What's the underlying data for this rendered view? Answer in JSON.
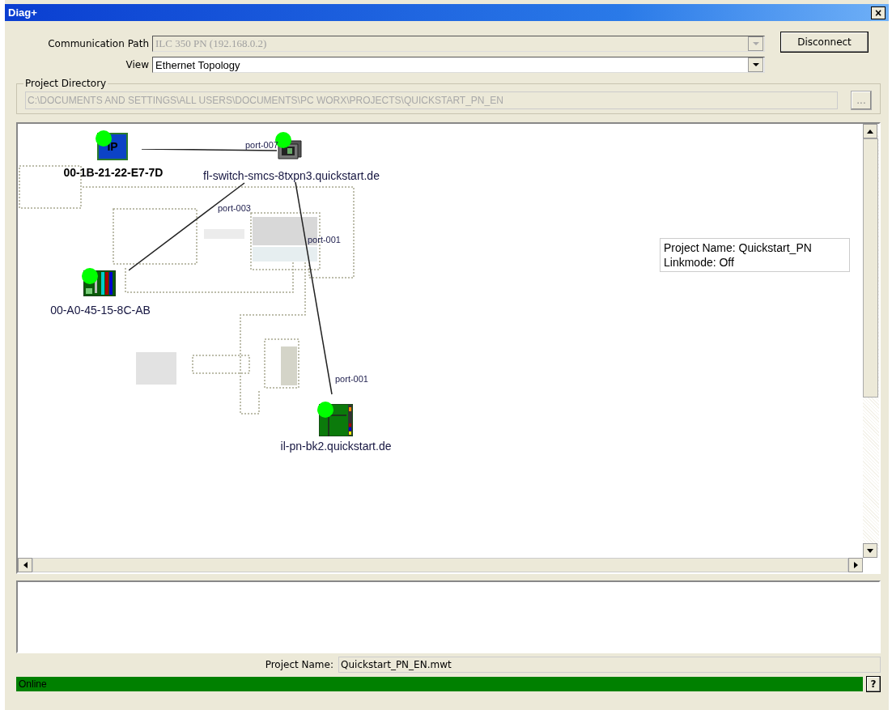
{
  "window": {
    "title": "Diag+",
    "close": "×"
  },
  "communication_path": {
    "label": "Communication Path",
    "value": "ILC 350 PN (192.168.0.2)",
    "disabled": true
  },
  "view": {
    "label": "View",
    "value": "Ethernet Topology",
    "disabled": false
  },
  "disconnect_button": "Disconnect",
  "project_directory": {
    "legend": "Project Directory",
    "value": "C:\\DOCUMENTS AND SETTINGS\\ALL USERS\\DOCUMENTS\\PC WORX\\PROJECTS\\QUICKSTART_PN_EN",
    "browse_button": "...",
    "disabled": true
  },
  "topology": {
    "nodes": [
      {
        "kind": "plc",
        "badge": "IP",
        "label": "00-1B-21-22-E7-7D",
        "online": true,
        "selected": true
      },
      {
        "kind": "switch",
        "label": "fl-switch-smcs-8txpn3.quickstart.de",
        "online": true,
        "selected": false
      },
      {
        "kind": "controller",
        "label": "00-A0-45-15-8C-AB",
        "online": true,
        "selected": false
      },
      {
        "kind": "bus-coupler",
        "label": "il-pn-bk2.quickstart.de",
        "online": true,
        "selected": false
      }
    ],
    "ports": [
      "port-007",
      "port-003",
      "port-001",
      "port-001"
    ],
    "info": [
      "Project Name: Quickstart_PN",
      "Linkmode: Off"
    ]
  },
  "project_name": {
    "label": "Project Name:",
    "value": "Quickstart_PN_EN.mwt"
  },
  "status_bar": {
    "text": "Online",
    "online": true,
    "help_button": "?"
  }
}
